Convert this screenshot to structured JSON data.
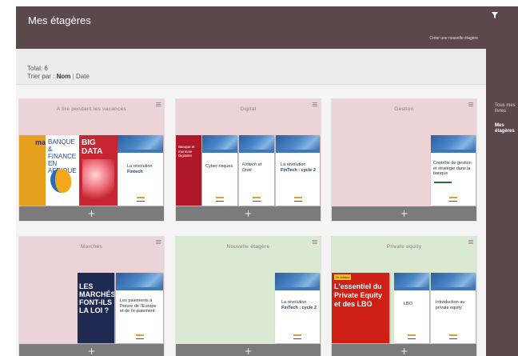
{
  "header": {
    "title": "Mes étagères",
    "create_link": "Créer une nouvelle étagère"
  },
  "toolbar": {
    "total": "Total: 6",
    "sort_label": "Trier par :",
    "sort_name": "Nom",
    "sort_separator": "|",
    "sort_date": "Date"
  },
  "sidebar": {
    "items": [
      {
        "label": "Tous mes livres"
      },
      {
        "label": "Mes étagères"
      }
    ]
  },
  "shelves": [
    {
      "name": "A lire pendant les vacances",
      "color": "#ecd3d6",
      "add": "+",
      "covers": {
        "partial_left": "ma",
        "banque": "BANQUE & FINANCE EN AFRIQUE",
        "bigdata": "BIG DATA",
        "fintech_title": "La révolution",
        "fintech_em": "Fintech"
      }
    },
    {
      "name": "Digital",
      "color": "#ecd3d6",
      "add": "+",
      "covers": {
        "red_title": "Banque et monnaie Digitales",
        "b1_title": "Cyber-risques",
        "b2_title": "Fintech et Droit",
        "b3_title_a": "La révolution",
        "b3_title_b": "FinTech : cycle 2"
      }
    },
    {
      "name": "Gestion",
      "color": "#ecd3d6",
      "add": "+",
      "covers": {
        "b1_title": "Contrôle de gestion et stratégie dans la banque"
      }
    },
    {
      "name": "Marchés",
      "color": "#ecd3d6",
      "add": "+",
      "covers": {
        "navy_title": "LES MARCHÉS FONT-ILS LA LOI ?",
        "b1_title": "Les paiements à l'heure de l'Europe et de l'e-paiement"
      }
    },
    {
      "name": "Nouvelle étagère",
      "color": "#d9e9d2",
      "add": "+",
      "covers": {
        "b1_title_a": "La révolution",
        "b1_title_b": "FinTech : cycle 2"
      }
    },
    {
      "name": "Private equity",
      "color": "#d9e9d2",
      "add": "+",
      "covers": {
        "red_badge": "2e édition",
        "red_title": "L'essentiel du Private Equity et des LBO",
        "b1_title": "LBO",
        "b2_title": "Introduction au private equity"
      }
    }
  ]
}
